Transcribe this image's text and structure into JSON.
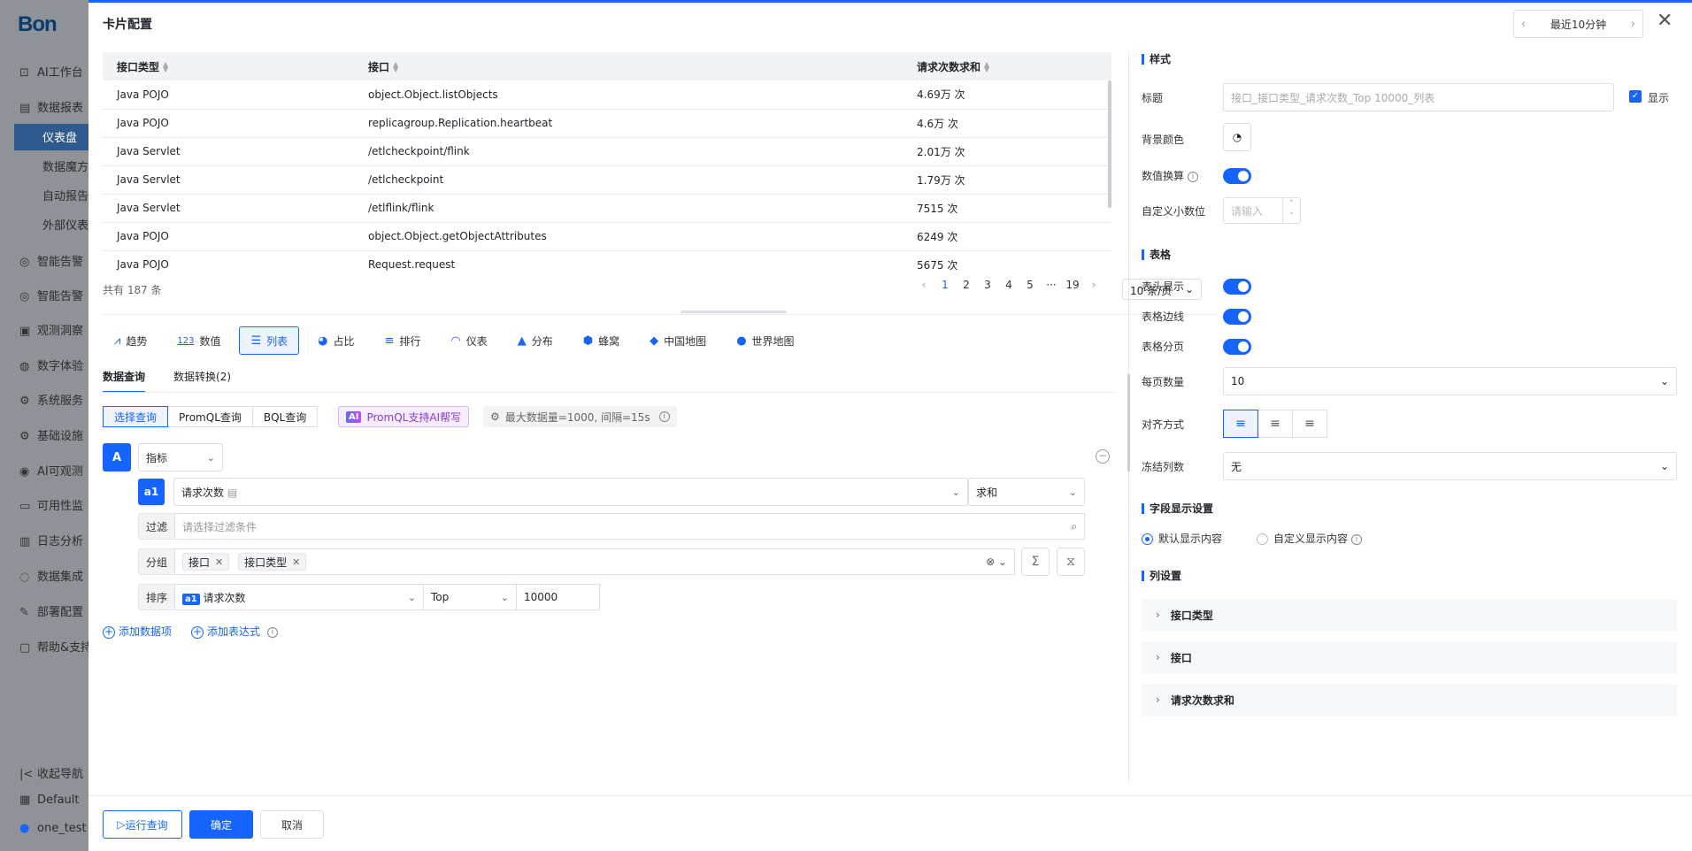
{
  "sidebar": {
    "logo": "Bon",
    "items": [
      {
        "icon": "ai-icon",
        "label": "AI工作台"
      },
      {
        "icon": "report-icon",
        "label": "数据报表"
      },
      {
        "icon": "",
        "label": "仪表盘"
      },
      {
        "icon": "",
        "label": "数据魔方"
      },
      {
        "icon": "",
        "label": "自动报告"
      },
      {
        "icon": "",
        "label": "外部仪表"
      },
      {
        "icon": "alert-icon",
        "label": "智能告警"
      },
      {
        "icon": "alert-icon",
        "label": "智能告警"
      },
      {
        "icon": "observe-icon",
        "label": "观测洞察"
      },
      {
        "icon": "experience-icon",
        "label": "数字体验"
      },
      {
        "icon": "service-icon",
        "label": "系统服务"
      },
      {
        "icon": "infra-icon",
        "label": "基础设施"
      },
      {
        "icon": "ai-observe-icon",
        "label": "AI可观测"
      },
      {
        "icon": "availability-icon",
        "label": "可用性监"
      },
      {
        "icon": "log-icon",
        "label": "日志分析"
      },
      {
        "icon": "integration-icon",
        "label": "数据集成"
      },
      {
        "icon": "deploy-icon",
        "label": "部署配置"
      },
      {
        "icon": "help-icon",
        "label": "帮助&支持"
      }
    ],
    "collapse": "收起导航",
    "workspace": "Default",
    "user": "one_test"
  },
  "drawer": {
    "title": "卡片配置",
    "time_range": "最近10分钟"
  },
  "table": {
    "headers": [
      "接口类型",
      "接口",
      "请求次数求和"
    ],
    "rows": [
      [
        "Java POJO",
        "object.Object.listObjects",
        "4.69万 次"
      ],
      [
        "Java POJO",
        "replicagroup.Replication.heartbeat",
        "4.6万 次"
      ],
      [
        "Java Servlet",
        "/etlcheckpoint/flink",
        "2.01万 次"
      ],
      [
        "Java Servlet",
        "/etlcheckpoint",
        "1.79万 次"
      ],
      [
        "Java Servlet",
        "/etlflink/flink",
        "7515 次"
      ],
      [
        "Java POJO",
        "object.Object.getObjectAttributes",
        "6249 次"
      ],
      [
        "Java POJO",
        "Request.request",
        "5675 次"
      ]
    ],
    "total": "共有 187 条",
    "pages": [
      "1",
      "2",
      "3",
      "4",
      "5",
      "···",
      "19"
    ],
    "current_page": "1",
    "page_size": "10 条/页"
  },
  "chart_types": [
    {
      "icon": "trend-icon",
      "label": "趋势"
    },
    {
      "icon": "number-icon",
      "label": "数值",
      "glyph": "123"
    },
    {
      "icon": "list-icon",
      "label": "列表"
    },
    {
      "icon": "pie-icon",
      "label": "占比"
    },
    {
      "icon": "rank-icon",
      "label": "排行"
    },
    {
      "icon": "gauge-icon",
      "label": "仪表"
    },
    {
      "icon": "distribution-icon",
      "label": "分布"
    },
    {
      "icon": "honeycomb-icon",
      "label": "蜂窝"
    },
    {
      "icon": "china-map-icon",
      "label": "中国地图"
    },
    {
      "icon": "world-map-icon",
      "label": "世界地图"
    }
  ],
  "active_chart_type": "列表",
  "sub_tabs": [
    "数据查询",
    "数据转换(2)"
  ],
  "query_modes": [
    "选择查询",
    "PromQL查询",
    "BQL查询"
  ],
  "ai_write": {
    "badge": "AI",
    "label": "PromQL支持AI帮写"
  },
  "max_data": "最大数据量=1000, 间隔=15s",
  "query": {
    "letter": "A",
    "metric_type": "指标",
    "a1": "a1",
    "metric": "请求次数",
    "agg": "求和",
    "filter_label": "过滤",
    "filter_placeholder": "请选择过滤条件",
    "group_label": "分组",
    "group_tags": [
      "接口",
      "接口类型"
    ],
    "sort_label": "排序",
    "sort_field": "请求次数",
    "sort_order": "Top",
    "limit": "10000"
  },
  "add_links": [
    "添加数据项",
    "添加表达式"
  ],
  "right": {
    "style_title": "样式",
    "title_label": "标题",
    "title_placeholder": "接口_接口类型_请求次数_Top 10000_列表",
    "show_label": "显示",
    "bg_label": "背景颜色",
    "value_conv_label": "数值换算",
    "decimal_label": "自定义小数位",
    "decimal_placeholder": "请输入",
    "table_title": "表格",
    "header_label": "表头显示",
    "border_label": "表格边线",
    "paging_label": "表格分页",
    "per_page_label": "每页数量",
    "per_page_value": "10",
    "align_label": "对齐方式",
    "freeze_label": "冻结列数",
    "freeze_value": "无",
    "field_title": "字段显示设置",
    "field_default": "默认显示内容",
    "field_custom": "自定义显示内容",
    "col_title": "列设置",
    "columns": [
      "接口类型",
      "接口",
      "请求次数求和"
    ]
  },
  "footer": {
    "run": "运行查询",
    "ok": "确定",
    "cancel": "取消"
  },
  "colors": {
    "accent": "#1664ff"
  }
}
